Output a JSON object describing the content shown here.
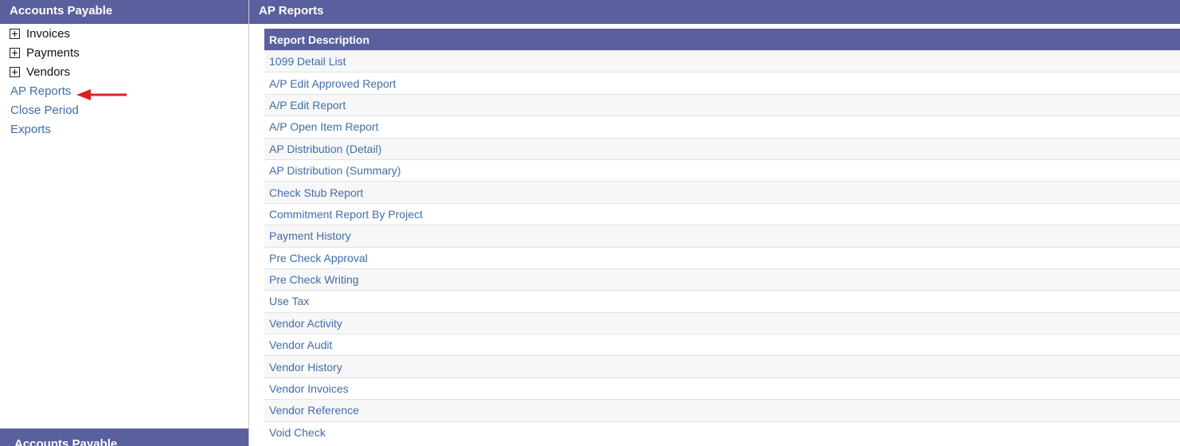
{
  "sidebar": {
    "title": "Accounts Payable",
    "tree_items": [
      {
        "label": "Invoices"
      },
      {
        "label": "Payments"
      },
      {
        "label": "Vendors"
      }
    ],
    "links": [
      {
        "label": "AP Reports"
      },
      {
        "label": "Close Period"
      },
      {
        "label": "Exports"
      }
    ],
    "footer_title": "Accounts Payable",
    "annotation_color": "#e02020"
  },
  "main": {
    "title": "AP Reports",
    "table": {
      "header": "Report Description",
      "rows": [
        "1099 Detail List",
        "A/P Edit Approved Report",
        "A/P Edit Report",
        "A/P Open Item Report",
        "AP Distribution (Detail)",
        "AP Distribution (Summary)",
        "Check Stub Report",
        "Commitment Report By Project",
        "Payment History",
        "Pre Check Approval",
        "Pre Check Writing",
        "Use Tax",
        "Vendor Activity",
        "Vendor Audit",
        "Vendor History",
        "Vendor Invoices",
        "Vendor Reference",
        "Void Check"
      ]
    }
  },
  "colors": {
    "header_bg": "#5a5f9e",
    "link": "#3f6ea8"
  }
}
